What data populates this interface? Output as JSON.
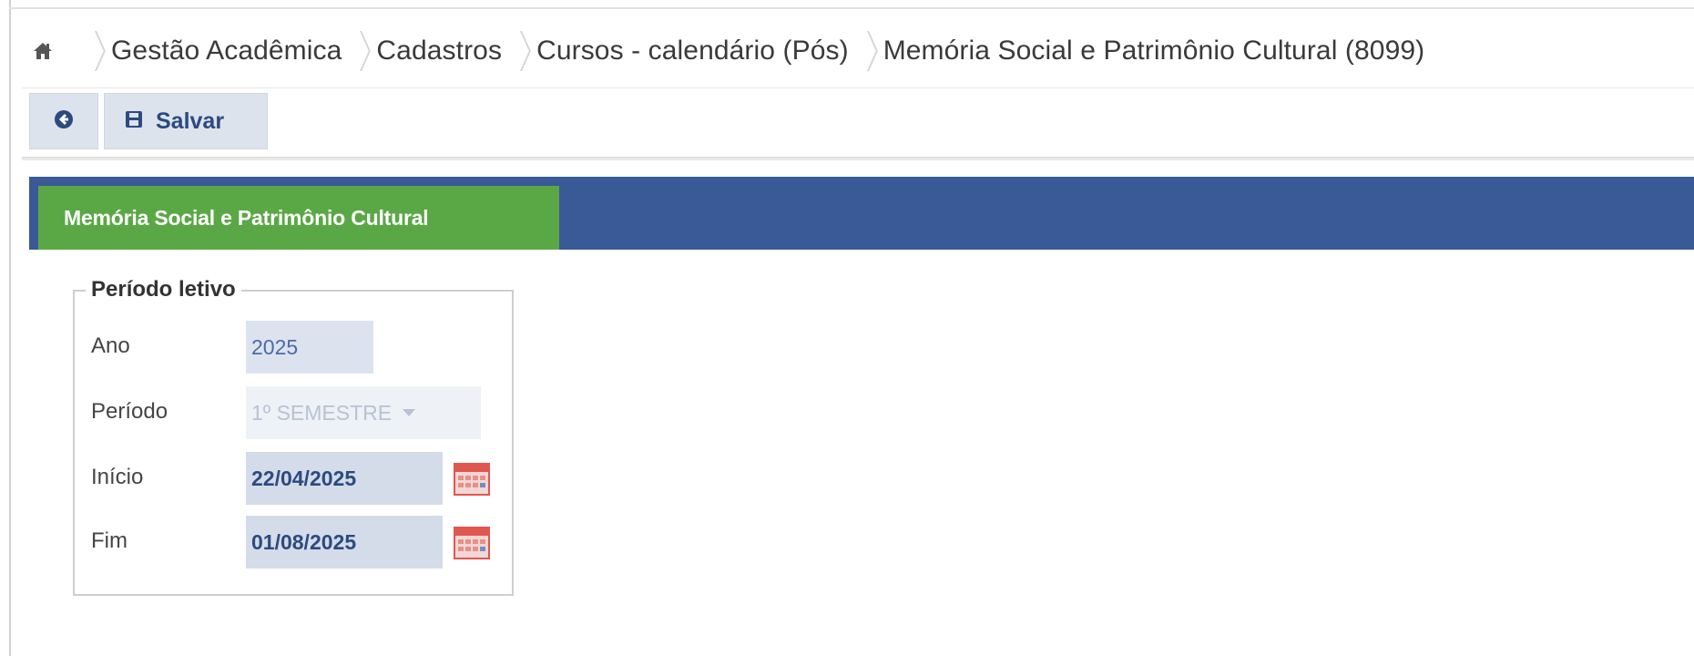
{
  "breadcrumb": {
    "home_icon": "home-icon",
    "items": [
      "Gestão Acadêmica",
      "Cadastros",
      "Cursos - calendário (Pós)",
      "Memória Social e Patrimônio Cultural (8099)"
    ]
  },
  "toolbar": {
    "back_icon": "arrow-left-circle-icon",
    "save_icon": "floppy-disk-icon",
    "save_label": "Salvar"
  },
  "panel": {
    "tab_label": "Memória Social e Patrimônio Cultural"
  },
  "periodo_letivo": {
    "legend": "Período letivo",
    "ano_label": "Ano",
    "ano_value": "2025",
    "periodo_label": "Período",
    "periodo_value": "1º SEMESTRE",
    "inicio_label": "Início",
    "inicio_value": "22/04/2025",
    "fim_label": "Fim",
    "fim_value": "01/08/2025",
    "calendar_icon": "calendar-icon"
  },
  "colors": {
    "header_blue": "#3a5997",
    "tab_green": "#5aa845",
    "toolbar_bg": "#dde3ed",
    "field_bg": "#d4dcea",
    "calendar_red": "#e0574f"
  }
}
